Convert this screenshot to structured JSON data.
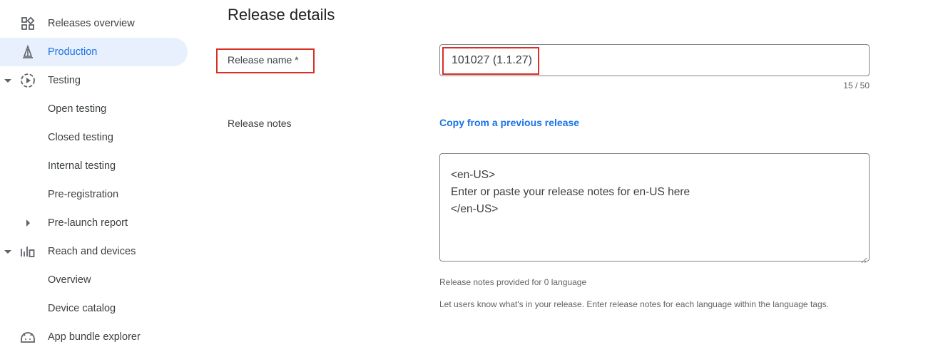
{
  "sidebar": {
    "items": [
      {
        "label": "Releases overview",
        "icon": "dashboard-icon"
      },
      {
        "label": "Production",
        "icon": "rocket-icon"
      },
      {
        "label": "Testing",
        "icon": "play-circle-icon"
      },
      {
        "label": "Open testing"
      },
      {
        "label": "Closed testing"
      },
      {
        "label": "Internal testing"
      },
      {
        "label": "Pre-registration"
      },
      {
        "label": "Pre-launch report"
      },
      {
        "label": "Reach and devices",
        "icon": "bar-chart-icon"
      },
      {
        "label": "Overview"
      },
      {
        "label": "Device catalog"
      },
      {
        "label": "App bundle explorer",
        "icon": "android-icon"
      }
    ]
  },
  "main": {
    "title": "Release details",
    "release_name": {
      "label": "Release name  *",
      "value": "101027 (1.1.27)",
      "counter": "15 / 50"
    },
    "release_notes": {
      "label": "Release notes",
      "copy_link": "Copy from a previous release",
      "lines": [
        "<en-US>",
        "Enter or paste your release notes for en-US here",
        "</en-US>"
      ],
      "provided": "Release notes provided for 0 language",
      "help": "Let users know what's in your release. Enter release notes for each language within the language tags."
    }
  },
  "colors": {
    "accent": "#1a73e8",
    "active_bg": "#e8f0fe",
    "highlight": "#d93025"
  }
}
